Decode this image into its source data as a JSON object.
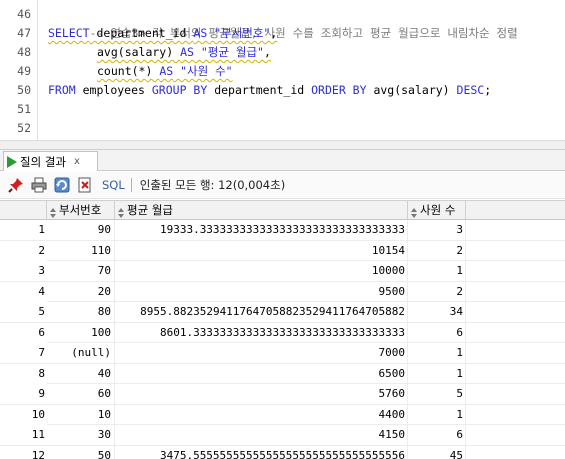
{
  "editor": {
    "lines": [
      {
        "number": "46",
        "comment": "-- 연습3> 각 부서의 평균월급, 사원 수를 조회하고 평균 월급으로 내림차순 정렬"
      },
      {
        "number": "47",
        "kw1": "SELECT",
        "t1": " department_id ",
        "kw2": "AS",
        "s1": " \"부서번호\"",
        "t2": ","
      },
      {
        "number": "48",
        "t1": "avg(salary) ",
        "kw1": "AS",
        "s1": " \"평균 월급\"",
        "t2": ","
      },
      {
        "number": "49",
        "t1": "count(*) ",
        "kw1": "AS",
        "s1": " \"사원 수\""
      },
      {
        "number": "50",
        "kw1": "FROM",
        "t1": " employees ",
        "kw2": "GROUP BY",
        "t2": " department_id ",
        "kw3": "ORDER BY",
        "t3": " avg(salary) ",
        "kw4": "DESC",
        "t4": ";"
      },
      {
        "number": "51"
      },
      {
        "number": "52"
      }
    ]
  },
  "results_tab": {
    "label": "질의 결과",
    "close": "x"
  },
  "toolbar": {
    "sql_label": "SQL",
    "status": "인출된 모든 행: 12(0,004초)"
  },
  "grid": {
    "columns": [
      "부서번호",
      "평균 월급",
      "사원 수"
    ],
    "rows": [
      {
        "n": "1",
        "dept": "90",
        "avg": "19333.3333333333333333333333333333333",
        "cnt": "3"
      },
      {
        "n": "2",
        "dept": "110",
        "avg": "10154",
        "cnt": "2"
      },
      {
        "n": "3",
        "dept": "70",
        "avg": "10000",
        "cnt": "1"
      },
      {
        "n": "4",
        "dept": "20",
        "avg": "9500",
        "cnt": "2"
      },
      {
        "n": "5",
        "dept": "80",
        "avg": "8955.88235294117647058823529411764705882",
        "cnt": "34"
      },
      {
        "n": "6",
        "dept": "100",
        "avg": "8601.33333333333333333333333333333333",
        "cnt": "6"
      },
      {
        "n": "7",
        "dept": "(null)",
        "avg": "7000",
        "cnt": "1"
      },
      {
        "n": "8",
        "dept": "40",
        "avg": "6500",
        "cnt": "1"
      },
      {
        "n": "9",
        "dept": "60",
        "avg": "5760",
        "cnt": "5"
      },
      {
        "n": "10",
        "dept": "10",
        "avg": "4400",
        "cnt": "1"
      },
      {
        "n": "11",
        "dept": "30",
        "avg": "4150",
        "cnt": "6"
      },
      {
        "n": "12",
        "dept": "50",
        "avg": "3475.55555555555555555555555555555556",
        "cnt": "45"
      }
    ]
  },
  "colors": {
    "keyword": "#2d2dd6",
    "comment": "#7a7a7a",
    "run_icon": "#2e9b2e"
  },
  "icons": [
    "pin-icon",
    "print-icon",
    "refresh-icon",
    "export-icon",
    "run-icon",
    "sort-icon"
  ]
}
